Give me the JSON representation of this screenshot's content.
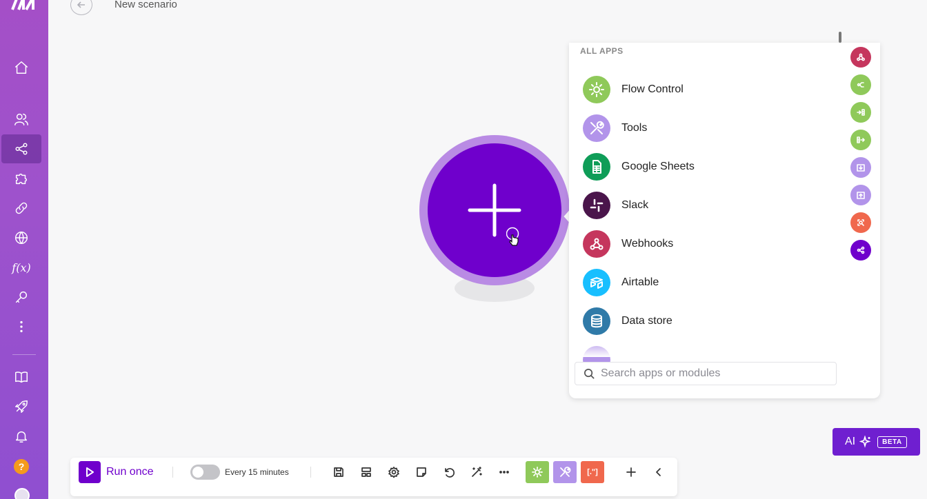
{
  "header": {
    "title": "New scenario"
  },
  "sidebar": {
    "items": [
      {
        "name": "home"
      },
      {
        "name": "team"
      },
      {
        "name": "scenarios",
        "active": true
      },
      {
        "name": "templates"
      },
      {
        "name": "connections"
      },
      {
        "name": "webhooks"
      },
      {
        "name": "functions",
        "label": "f(x)"
      },
      {
        "name": "keys"
      },
      {
        "name": "more"
      },
      {
        "name": "docs"
      },
      {
        "name": "whats-new"
      },
      {
        "name": "notifications"
      },
      {
        "name": "help",
        "label": "?"
      }
    ]
  },
  "apps_panel": {
    "heading": "ALL APPS",
    "apps": [
      {
        "label": "Flow Control",
        "color": "#8fc95a",
        "icon": "gear-icon"
      },
      {
        "label": "Tools",
        "color": "#b294ea",
        "icon": "tools-icon"
      },
      {
        "label": "Google Sheets",
        "color": "#0f9d58",
        "icon": "sheet-icon"
      },
      {
        "label": "Slack",
        "color": "#4a154b",
        "icon": "slack-icon"
      },
      {
        "label": "Webhooks",
        "color": "#c5365d",
        "icon": "webhook-icon"
      },
      {
        "label": "Airtable",
        "color": "#18bfff",
        "icon": "airtable-icon"
      },
      {
        "label": "Data store",
        "color": "#2f7aa8",
        "icon": "database-icon"
      }
    ],
    "search_placeholder": "Search apps or modules"
  },
  "side_icons": [
    {
      "color": "#c5365d",
      "icon": "webhook-icon"
    },
    {
      "color": "#8fc95a",
      "icon": "router-icon"
    },
    {
      "color": "#8fc95a",
      "icon": "aggregator-icon"
    },
    {
      "color": "#8fc95a",
      "icon": "iterator-icon"
    },
    {
      "color": "#b294ea",
      "icon": "download-icon"
    },
    {
      "color": "#b294ea",
      "icon": "upload-icon"
    },
    {
      "color": "#f0684d",
      "icon": "search-icon"
    },
    {
      "color": "#6f00cc",
      "icon": "share-icon"
    }
  ],
  "ai": {
    "label": "AI",
    "badge": "BETA"
  },
  "toolbar": {
    "run_label": "Run once",
    "schedule": "Every 15 minutes",
    "app_badge_text": "[.\"]"
  }
}
